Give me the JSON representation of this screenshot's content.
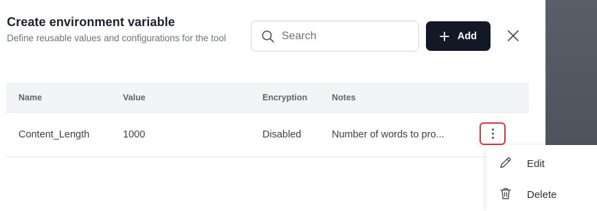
{
  "dialog": {
    "title": "Create environment variable",
    "subtitle": "Define reusable values and configurations for the tool",
    "search_placeholder": "Search",
    "add_label": "Add"
  },
  "table": {
    "columns": [
      "Name",
      "Value",
      "Encryption",
      "Notes"
    ],
    "rows": [
      {
        "name": "Content_Length",
        "value": "1000",
        "encryption": "Disabled",
        "notes": "Number of words to pro..."
      }
    ]
  },
  "context_menu": {
    "items": [
      {
        "label": "Edit",
        "icon": "pencil-icon"
      },
      {
        "label": "Delete",
        "icon": "trash-icon"
      }
    ]
  },
  "colors": {
    "primary_button": "#121826",
    "highlight_border": "#e0343c",
    "backdrop": "#4d515b"
  }
}
